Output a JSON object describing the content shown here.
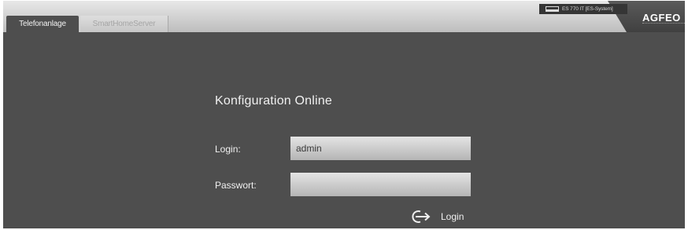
{
  "tabs": [
    {
      "label": "Telefonanlage",
      "active": true
    },
    {
      "label": "SmartHomeServer",
      "active": false
    }
  ],
  "header": {
    "device_label": "ES 770 IT [ES-System]",
    "brand": "AGFEO"
  },
  "login": {
    "title": "Konfiguration Online",
    "login_label": "Login:",
    "login_value": "admin",
    "password_label": "Passwort:",
    "password_value": "",
    "submit_label": "Login"
  },
  "icons": {
    "device": "monitor-icon",
    "submit": "login-arrow-icon"
  },
  "colors": {
    "background": "#4e4e4e",
    "header": "#d0d0d0",
    "text": "#f0f0f0",
    "input": "#d4d4d4"
  }
}
